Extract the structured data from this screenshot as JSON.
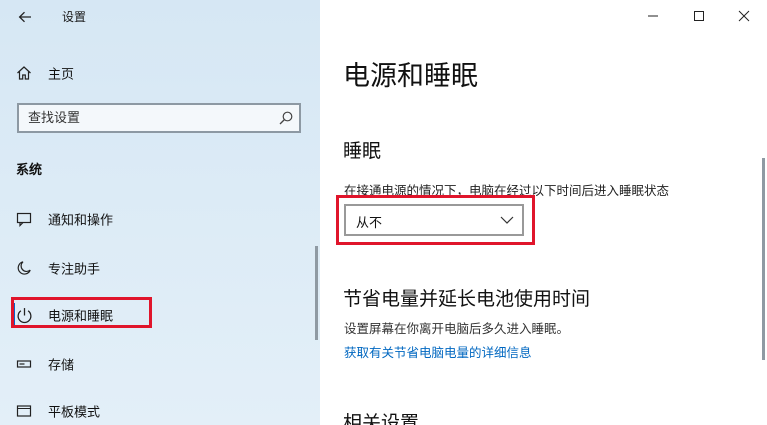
{
  "window": {
    "app_title": "设置",
    "minimize_icon": "minimize-icon",
    "maximize_icon": "maximize-icon",
    "close_icon": "close-icon"
  },
  "sidebar": {
    "home_label": "主页",
    "search": {
      "placeholder": "查找设置",
      "value": ""
    },
    "section_label": "系统",
    "items": [
      {
        "label": "通知和操作",
        "icon": "notification-icon"
      },
      {
        "label": "专注助手",
        "icon": "moon-icon"
      },
      {
        "label": "电源和睡眠",
        "icon": "power-icon",
        "selected": true
      },
      {
        "label": "存储",
        "icon": "storage-icon"
      },
      {
        "label": "平板模式",
        "icon": "tablet-icon"
      }
    ]
  },
  "main": {
    "title": "电源和睡眠",
    "sleep": {
      "heading": "睡眠",
      "description": "在接通电源的情况下，电脑在经过以下时间后进入睡眠状态",
      "selected_value": "从不"
    },
    "battery": {
      "heading": "节省电量并延长电池使用时间",
      "description": "设置屏幕在你离开电脑后多久进入睡眠。",
      "link": "获取有关节省电脑电量的详细信息"
    },
    "related": {
      "heading": "相关设置"
    }
  },
  "colors": {
    "accent": "#0067c0",
    "highlight": "#e0152b",
    "sidebar_bg": "#d6e7f4"
  }
}
